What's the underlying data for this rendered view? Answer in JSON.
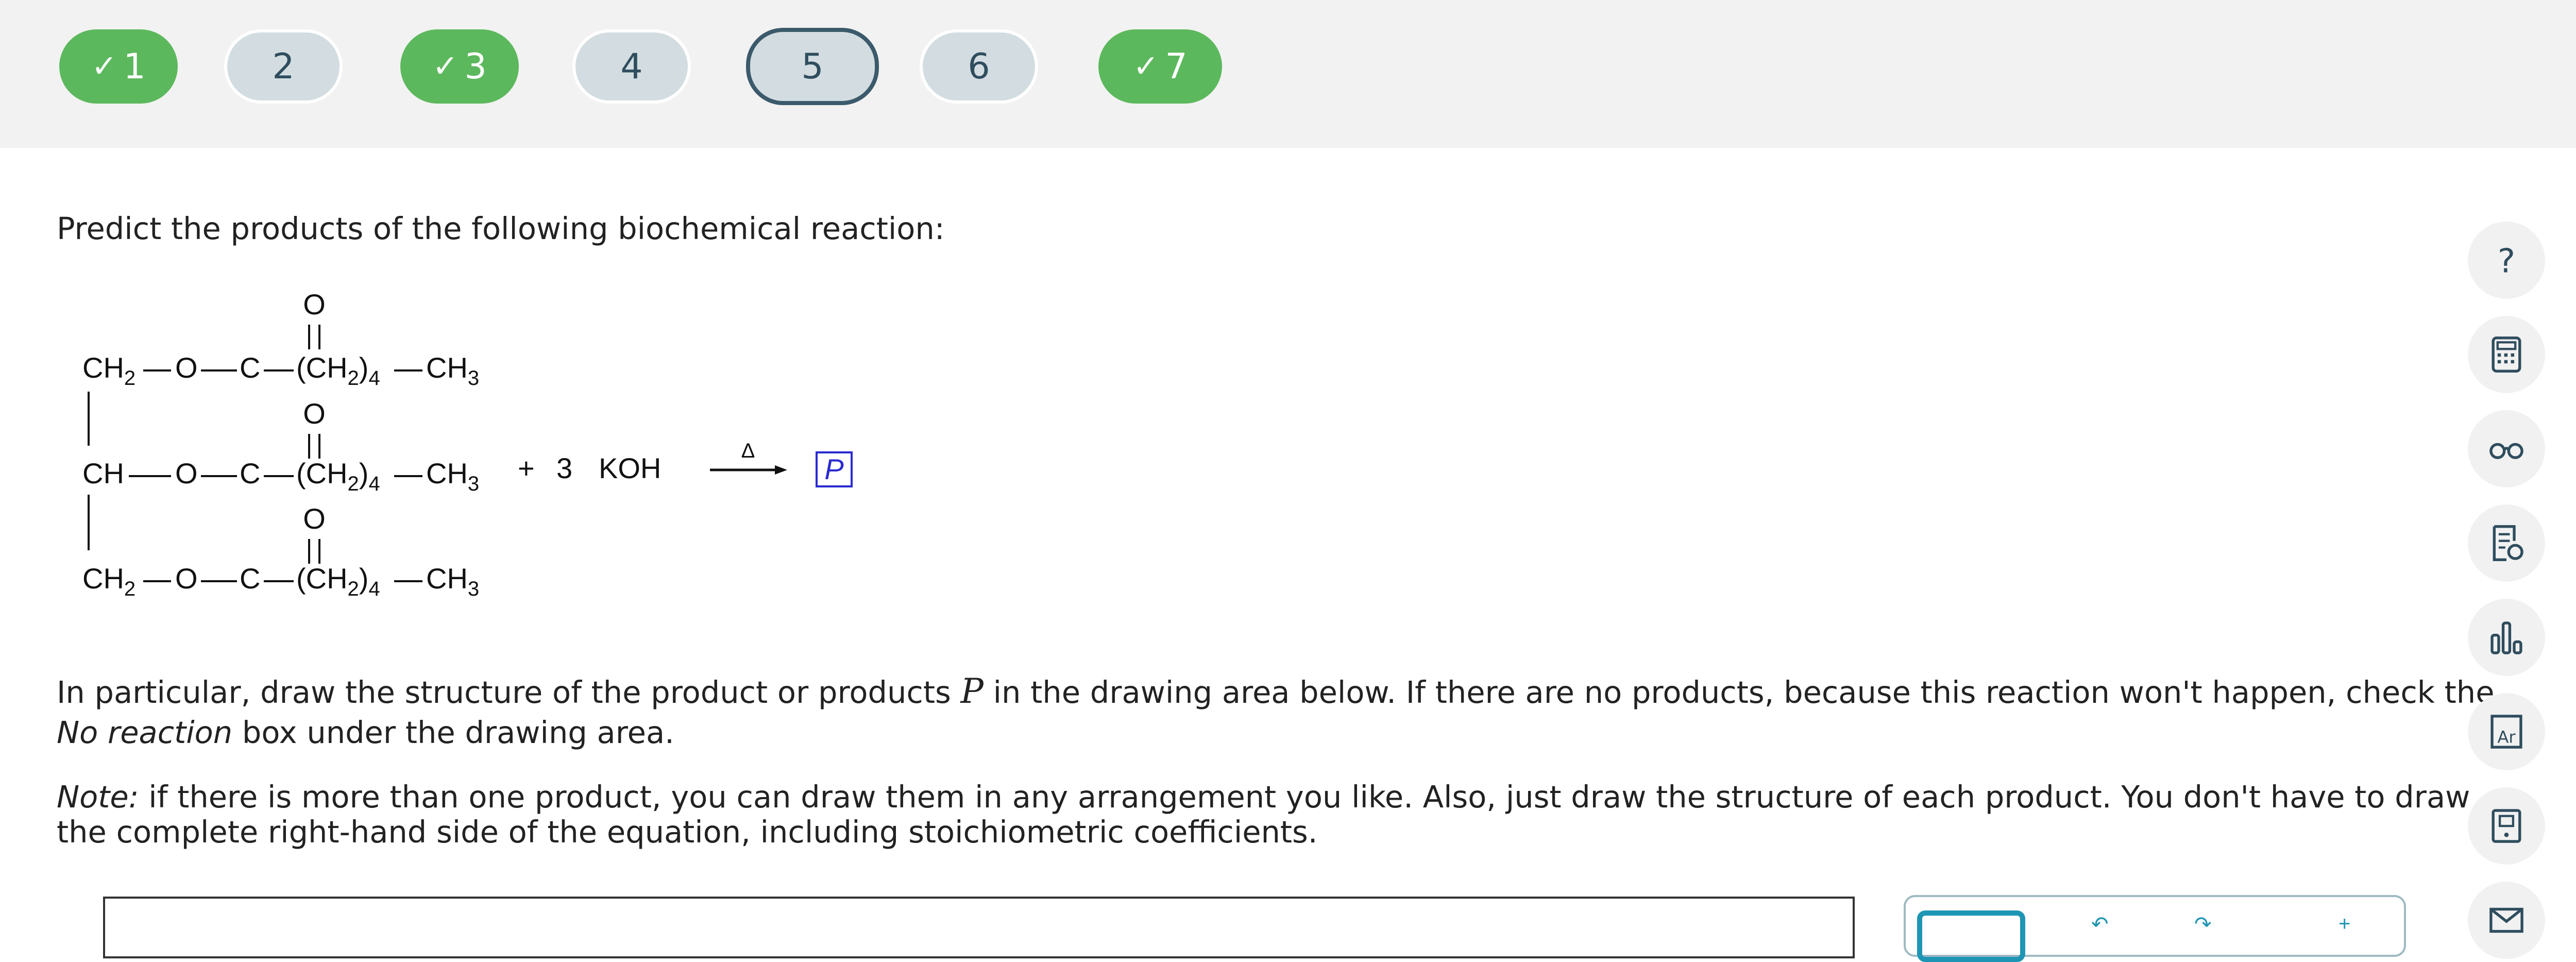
{
  "question_nav": [
    {
      "label": "1",
      "status": "done"
    },
    {
      "label": "2",
      "status": "todo"
    },
    {
      "label": "3",
      "status": "done"
    },
    {
      "label": "4",
      "status": "todo"
    },
    {
      "label": "5",
      "status": "current"
    },
    {
      "label": "6",
      "status": "todo"
    },
    {
      "label": "7",
      "status": "done"
    }
  ],
  "prompt": {
    "intro": "Predict the products of the following biochemical reaction:",
    "para1_a": "In particular, draw the structure of the product or products ",
    "para1_var": "P",
    "para1_b": " in the drawing area below. If there are no products, because this reaction won't happen, check the",
    "para1_italic": "No reaction",
    "para1_c": " box under the drawing area.",
    "note_label": "Note:",
    "note_line1": " if there is more than one product, you can draw them in any arrangement you like. Also, just draw the structure of each product. You don't have to draw",
    "note_line2": "the complete right-hand side of the equation, including stoichiometric coefficients."
  },
  "reaction": {
    "carbonyl_o": "O",
    "c": "C",
    "o": "O",
    "ch2": "CH",
    "ch": "CH",
    "chain": "(CH",
    "chain_close": ")",
    "ch3": "CH",
    "sub2": "2",
    "sub3": "3",
    "sub4": "4",
    "reagent_plus": "+",
    "reagent_coef": "3",
    "reagent": "KOH",
    "condition": "Δ",
    "product_box": "P"
  },
  "side_tools": [
    {
      "icon": "help-icon"
    },
    {
      "icon": "calculator-icon"
    },
    {
      "icon": "glasses-icon"
    },
    {
      "icon": "document-lightbulb-icon"
    },
    {
      "icon": "bar-chart-icon"
    },
    {
      "icon": "periodic-table-icon"
    },
    {
      "icon": "book-icon"
    },
    {
      "icon": "mail-icon"
    }
  ],
  "colors": {
    "done": "#5cb85c",
    "todo": "#d3dde1",
    "current_border": "#3b5a6b",
    "accent": "#1e95b4",
    "product_box": "#2a2ad0"
  }
}
